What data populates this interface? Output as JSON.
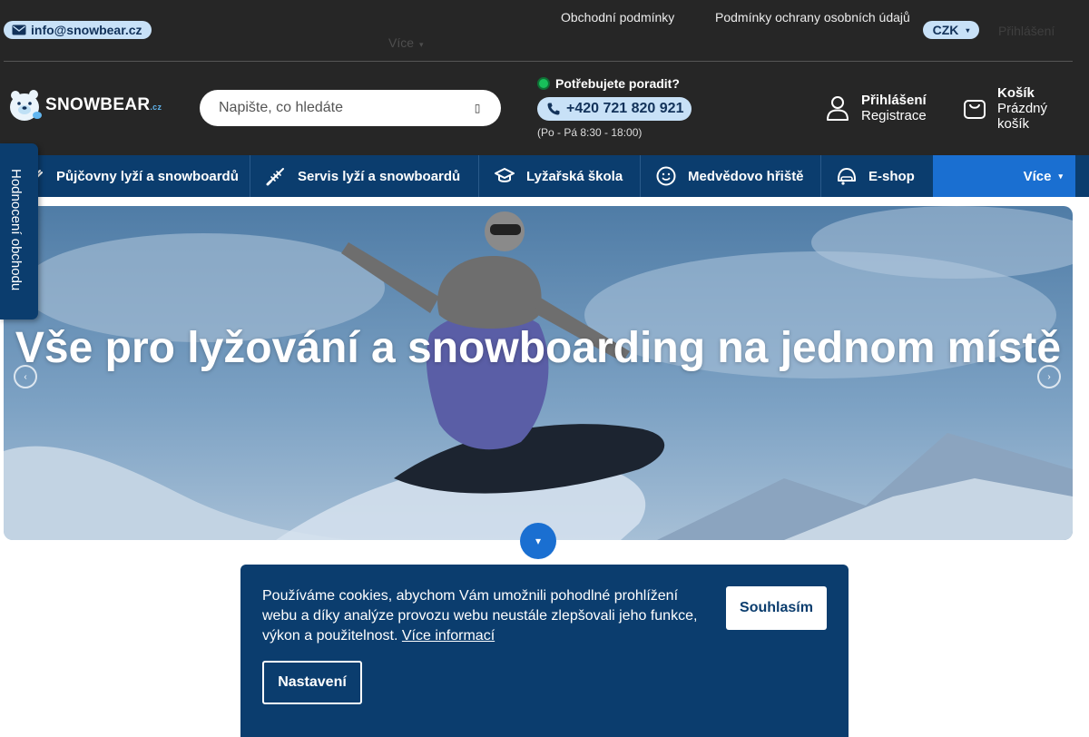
{
  "topbar": {
    "email": "info@snowbear.cz",
    "links": [
      "Obchodní podmínky",
      "Podmínky ochrany osobních údajů"
    ],
    "more_label": "Více",
    "currency": "CZK",
    "login_label": "Přihlášení"
  },
  "header": {
    "logo_text": "SNOWBEAR",
    "logo_suffix": ".cz",
    "search_placeholder": "Napište, co hledáte",
    "help_label": "Potřebujete poradit?",
    "phone": "+420 721 820 921",
    "hours": "(Po - Pá 8:30 - 18:00)",
    "account": {
      "login": "Přihlášení",
      "register": "Registrace"
    },
    "cart": {
      "title": "Košík",
      "status": "Prázdný košík"
    }
  },
  "nav": {
    "items": [
      {
        "label": "Půjčovny lyží a snowboardů",
        "icon": "ski-icon"
      },
      {
        "label": "Servis lyží a snowboardů",
        "icon": "ski-service-icon"
      },
      {
        "label": "Lyžařská škola",
        "icon": "graduation-cap-icon"
      },
      {
        "label": "Medvědovo hřiště",
        "icon": "bear-face-icon"
      },
      {
        "label": "E-shop",
        "icon": "helmet-icon"
      }
    ],
    "more_label": "Více"
  },
  "rating_tab": {
    "label": "Hodnocení obchodu"
  },
  "hero": {
    "title": "Vše pro lyžování a snowboarding na jednom místě"
  },
  "cookie": {
    "text": "Používáme cookies, abychom Vám umožnili pohodlné prohlížení webu a díky analýze provozu webu neustále zlepšovali jeho funkce, výkon a použitelnost.",
    "more_link": "Více informací",
    "agree_label": "Souhlasím",
    "settings_label": "Nastavení"
  },
  "colors": {
    "header_bg": "#262626",
    "nav_bg": "#0b3d6e",
    "accent": "#1a6fd1",
    "pill_bg": "#c8e1f7"
  }
}
